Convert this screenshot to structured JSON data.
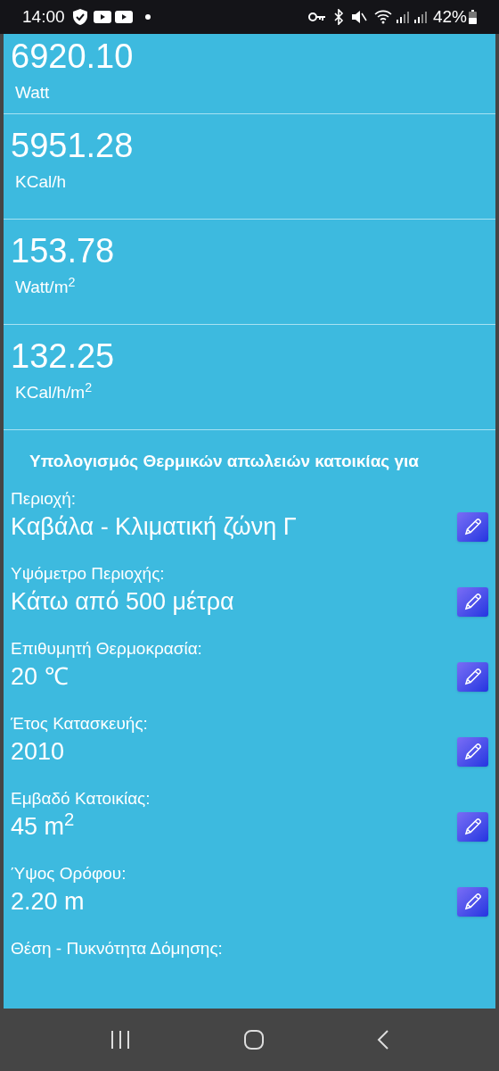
{
  "status_bar": {
    "time": "14:00",
    "battery": "42%"
  },
  "results": [
    {
      "value": "6920.10",
      "unit": "Watt"
    },
    {
      "value": "5951.28",
      "unit": "KCal/h"
    },
    {
      "value": "153.78",
      "unit": "Watt/m$^{2}$"
    },
    {
      "value": "132.25",
      "unit": "KCal/h/m$^{2}$"
    }
  ],
  "heading": "Υπολογισμός Θερμικών απωλειών κατοικίας για",
  "fields": [
    {
      "label": "Περιοχή:",
      "value": "Καβάλα - Κλιματική ζώνη Γ"
    },
    {
      "label": "Υψόμετρο Περιοχής:",
      "value": "Κάτω από 500 μέτρα"
    },
    {
      "label": "Επιθυμητή Θερμοκρασία:",
      "value": "20 ℃"
    },
    {
      "label": "Έτος Κατασκευής:",
      "value": "2010"
    },
    {
      "label": "Εμβαδό Κατοικίας:",
      "value": "45 m$^{2}$"
    },
    {
      "label": "Ύψος Ορόφου:",
      "value": "2.20 m"
    },
    {
      "label": "Θέση - Πυκνότητα Δόμησης:"
    }
  ]
}
